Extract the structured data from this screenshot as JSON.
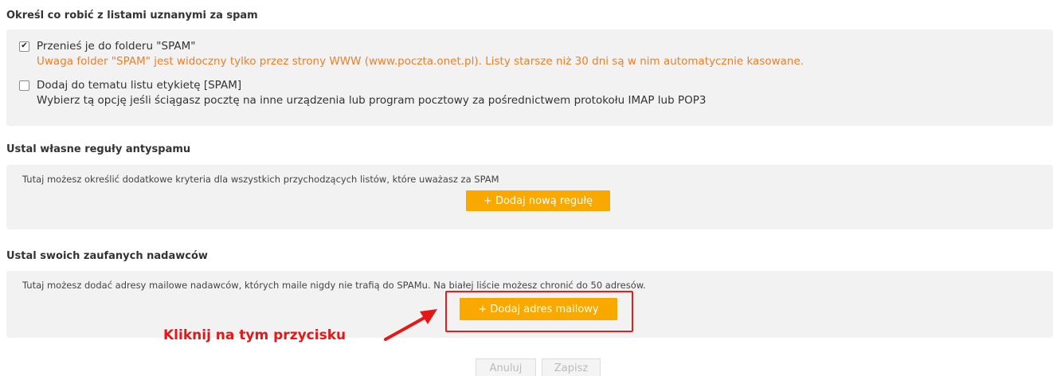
{
  "spam_handling": {
    "title": "Określ co robić z listami uznanymi za spam",
    "move_option": {
      "label": "Przenieś je do folderu \"SPAM\"",
      "checked": true,
      "description": "Uwaga folder \"SPAM\" jest widoczny tylko przez strony WWW (www.poczta.onet.pl). Listy starsze niż 30 dni są w nim automatycznie kasowane."
    },
    "tag_option": {
      "label": "Dodaj do tematu listu etykietę [SPAM]",
      "checked": false,
      "description": "Wybierz tą opcję jeśli ściągasz pocztę na inne urządzenia lub program pocztowy za pośrednictwem protokołu IMAP lub POP3"
    }
  },
  "antispam_rules": {
    "title": "Ustal własne reguły antyspamu",
    "description": "Tutaj możesz określić dodatkowe kryteria dla wszystkich przychodzących listów, które uważasz za SPAM",
    "add_rule_button": "+ Dodaj nową regułę"
  },
  "trusted_senders": {
    "title": "Ustal swoich zaufanych nadawców",
    "description": "Tutaj możesz dodać adresy mailowe nadawców, których maile nigdy nie trafią do SPAMu. Na białej liście możesz chronić do 50 adresów.",
    "add_address_button": "+ Dodaj adres mailowy"
  },
  "annotation": {
    "text": "Kliknij na tym przycisku",
    "color": "#e51717"
  },
  "footer": {
    "cancel_label": "Anuluj",
    "save_label": "Zapisz"
  },
  "colors": {
    "accent_button": "#f9a800",
    "warning_text": "#f07e26",
    "panel_bg": "#f2f2f2"
  }
}
